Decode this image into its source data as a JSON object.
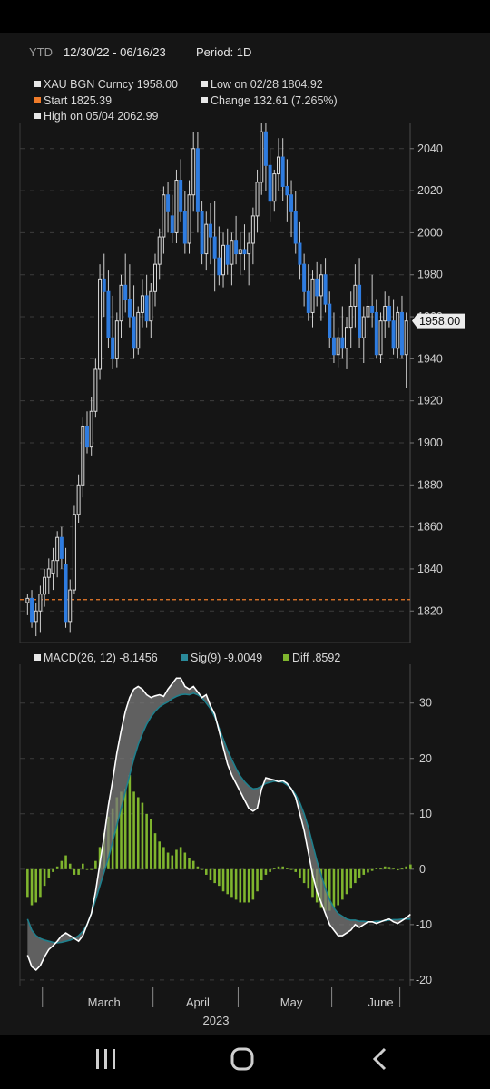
{
  "header": {
    "range_label": "YTD",
    "date_range": "12/30/22 - 06/16/23",
    "period": "Period: 1D"
  },
  "legend": [
    {
      "text": "XAU BGN Curncy 1958.00",
      "color": "#e8e8e8"
    },
    {
      "text": "Low on 02/28 1804.92",
      "color": "#e8e8e8"
    },
    {
      "text": "Start 1825.39",
      "color": "#f07c2a"
    },
    {
      "text": "Change 132.61 (7.265%)",
      "color": "#e8e8e8"
    },
    {
      "text": "High on 05/04 2062.99",
      "color": "#e8e8e8"
    }
  ],
  "last_price_label": "1958.00",
  "macd_legend": [
    {
      "text": "MACD(26, 12) -8.1456",
      "color": "#e8e8e8"
    },
    {
      "text": "Sig(9) -9.0049",
      "color": "#2a8a9a"
    },
    {
      "text": "Diff .8592",
      "color": "#7fb52e"
    }
  ],
  "colors": {
    "up": "#d8d8d8",
    "down": "#2f7ce0",
    "start_line": "#f07c2a",
    "macd": "#ffffff",
    "signal": "#1f7f8c",
    "diff": "#7fb52e",
    "fill": "#7a7a7a"
  },
  "chart_data": [
    {
      "type": "candlestick",
      "title": "XAU BGN Curncy",
      "ylim": [
        1805,
        2052
      ],
      "y_ticks": [
        1820,
        1840,
        1860,
        1880,
        1900,
        1920,
        1940,
        1960,
        1980,
        2000,
        2020,
        2040
      ],
      "start_value": 1825.39,
      "last_value": 1958.0,
      "ohlc": [
        [
          1824,
          1828,
          1818,
          1826
        ],
        [
          1826,
          1830,
          1812,
          1815
        ],
        [
          1815,
          1824,
          1808,
          1820
        ],
        [
          1820,
          1832,
          1810,
          1828
        ],
        [
          1828,
          1840,
          1822,
          1836
        ],
        [
          1836,
          1845,
          1828,
          1840
        ],
        [
          1838,
          1850,
          1830,
          1844
        ],
        [
          1844,
          1858,
          1836,
          1855
        ],
        [
          1855,
          1860,
          1840,
          1845
        ],
        [
          1842,
          1850,
          1812,
          1815
        ],
        [
          1815,
          1835,
          1810,
          1830
        ],
        [
          1830,
          1870,
          1828,
          1866
        ],
        [
          1866,
          1885,
          1862,
          1880
        ],
        [
          1880,
          1912,
          1874,
          1908
        ],
        [
          1908,
          1915,
          1895,
          1898
        ],
        [
          1898,
          1922,
          1894,
          1915
        ],
        [
          1915,
          1940,
          1912,
          1935
        ],
        [
          1935,
          1985,
          1930,
          1978
        ],
        [
          1978,
          1990,
          1960,
          1972
        ],
        [
          1972,
          1982,
          1945,
          1950
        ],
        [
          1950,
          1970,
          1935,
          1940
        ],
        [
          1940,
          1962,
          1936,
          1958
        ],
        [
          1958,
          1980,
          1950,
          1975
        ],
        [
          1975,
          1990,
          1962,
          1968
        ],
        [
          1968,
          1985,
          1955,
          1960
        ],
        [
          1960,
          1975,
          1940,
          1945
        ],
        [
          1945,
          1965,
          1942,
          1962
        ],
        [
          1962,
          1978,
          1955,
          1970
        ],
        [
          1970,
          1980,
          1955,
          1958
        ],
        [
          1958,
          1976,
          1950,
          1972
        ],
        [
          1972,
          1990,
          1965,
          1985
        ],
        [
          1985,
          2002,
          1978,
          1998
        ],
        [
          1998,
          2022,
          1990,
          2018
        ],
        [
          2018,
          2024,
          2000,
          2010
        ],
        [
          2008,
          2018,
          1995,
          2000
        ],
        [
          2000,
          2030,
          1995,
          2025
        ],
        [
          2025,
          2035,
          2005,
          2010
        ],
        [
          2010,
          2020,
          1990,
          1995
        ],
        [
          1995,
          2025,
          1990,
          2018
        ],
        [
          2018,
          2048,
          2010,
          2040
        ],
        [
          2040,
          2048,
          2000,
          2010
        ],
        [
          2010,
          2015,
          1985,
          1990
        ],
        [
          1990,
          2010,
          1982,
          2004
        ],
        [
          2004,
          2014,
          1985,
          1998
        ],
        [
          1998,
          2015,
          1972,
          1988
        ],
        [
          1988,
          2003,
          1975,
          1980
        ],
        [
          1980,
          2000,
          1974,
          1994
        ],
        [
          1994,
          2002,
          1980,
          1985
        ],
        [
          1985,
          2000,
          1975,
          1996
        ],
        [
          1996,
          2008,
          1985,
          1990
        ],
        [
          1990,
          2000,
          1980,
          1992
        ],
        [
          1992,
          2004,
          1982,
          1990
        ],
        [
          1990,
          2000,
          1975,
          1995
        ],
        [
          1995,
          2012,
          1985,
          2008
        ],
        [
          2008,
          2030,
          2000,
          2024
        ],
        [
          2024,
          2052,
          2018,
          2048
        ],
        [
          2048,
          2052,
          2020,
          2032
        ],
        [
          2032,
          2040,
          2005,
          2015
        ],
        [
          2015,
          2030,
          2010,
          2028
        ],
        [
          2028,
          2045,
          2020,
          2036
        ],
        [
          2036,
          2045,
          2015,
          2022
        ],
        [
          2022,
          2035,
          2005,
          2018
        ],
        [
          2018,
          2025,
          1998,
          2010
        ],
        [
          2010,
          2020,
          1990,
          1995
        ],
        [
          1995,
          2005,
          1978,
          1985
        ],
        [
          1985,
          1990,
          1965,
          1972
        ],
        [
          1972,
          1985,
          1958,
          1962
        ],
        [
          1962,
          1982,
          1955,
          1978
        ],
        [
          1978,
          1986,
          1965,
          1970
        ],
        [
          1970,
          1985,
          1958,
          1980
        ],
        [
          1980,
          1988,
          1962,
          1966
        ],
        [
          1966,
          1972,
          1945,
          1950
        ],
        [
          1950,
          1962,
          1938,
          1942
        ],
        [
          1942,
          1955,
          1936,
          1950
        ],
        [
          1950,
          1965,
          1940,
          1945
        ],
        [
          1945,
          1960,
          1935,
          1955
        ],
        [
          1955,
          1972,
          1945,
          1965
        ],
        [
          1965,
          1985,
          1955,
          1975
        ],
        [
          1975,
          1988,
          1945,
          1950
        ],
        [
          1950,
          1965,
          1938,
          1960
        ],
        [
          1960,
          1970,
          1950,
          1965
        ],
        [
          1965,
          1980,
          1955,
          1962
        ],
        [
          1962,
          1968,
          1940,
          1942
        ],
        [
          1942,
          1962,
          1938,
          1958
        ],
        [
          1958,
          1972,
          1950,
          1965
        ],
        [
          1965,
          1970,
          1955,
          1958
        ],
        [
          1958,
          1968,
          1942,
          1945
        ],
        [
          1945,
          1965,
          1940,
          1962
        ],
        [
          1962,
          1970,
          1940,
          1942
        ],
        [
          1942,
          1962,
          1926,
          1958
        ]
      ]
    },
    {
      "type": "macd",
      "series": [
        {
          "name": "MACD(26, 12)",
          "values": [
            -15.5,
            -17.6,
            -18.2,
            -17.4,
            -15.8,
            -14.5,
            -13.8,
            -13,
            -12,
            -11.5,
            -12,
            -12.5,
            -13,
            -12,
            -10,
            -8,
            -4,
            1,
            6,
            11.5,
            16,
            21,
            25,
            28.5,
            31,
            32.5,
            33,
            32.5,
            31.5,
            31,
            31.3,
            31.5,
            31.2,
            32.5,
            33.5,
            34.5,
            34.5,
            33,
            32.5,
            33,
            32,
            31,
            31.5,
            29.5,
            28,
            25,
            22,
            19,
            17,
            15.5,
            14,
            12.5,
            11,
            10.5,
            11,
            14.5,
            16.5,
            16.3,
            16.1,
            15.8,
            16,
            15.5,
            14.5,
            13,
            10,
            7,
            3,
            -1,
            -4,
            -6,
            -8,
            -10,
            -11,
            -12,
            -12,
            -11.5,
            -11,
            -10,
            -10.5,
            -10,
            -9.5,
            -9.5,
            -9.8,
            -9.5,
            -9.2,
            -9,
            -9.5,
            -9.8,
            -9.3,
            -8.8,
            -8.1456
          ]
        },
        {
          "name": "Sig(9)",
          "values": [
            -9,
            -11,
            -12,
            -12.5,
            -12.8,
            -13,
            -13.2,
            -13.3,
            -13.2,
            -13,
            -12.8,
            -12.5,
            -12,
            -11.2,
            -10,
            -8,
            -5.5,
            -3,
            -0.5,
            2,
            5,
            8,
            11,
            14,
            17,
            20,
            22.5,
            24.5,
            26.2,
            27.5,
            28.5,
            29.3,
            29.8,
            30.2,
            30.8,
            31.2,
            31.5,
            31.6,
            31.5,
            31.8,
            31.5,
            31,
            30,
            29,
            27.5,
            25.5,
            23.5,
            21.5,
            19.8,
            18.2,
            16.8,
            15.8,
            15,
            14.5,
            14.6,
            15,
            15.5,
            15.7,
            15.9,
            15.8,
            15.7,
            15.2,
            14.5,
            13.5,
            12,
            10,
            7.5,
            4.5,
            1.5,
            -1,
            -3.5,
            -5.5,
            -7,
            -8,
            -8.5,
            -9,
            -9.2,
            -9.2,
            -9.4,
            -9.4,
            -9.5,
            -9.5,
            -9.4,
            -9.4,
            -9.3,
            -9.2,
            -9.1,
            -9.1,
            -9.0,
            -9.0,
            -9.0049
          ]
        },
        {
          "name": "Diff",
          "values": [
            -5,
            -6.5,
            -6,
            -5,
            -3,
            -1.5,
            -0.5,
            0.5,
            1.5,
            2.5,
            1,
            -1,
            -1,
            1,
            0,
            0,
            1.5,
            4,
            6.5,
            9.5,
            11,
            13,
            14,
            14.5,
            17,
            14,
            13,
            12,
            10,
            9,
            6.5,
            5,
            4,
            3,
            2.5,
            3.5,
            4,
            3,
            2,
            1.5,
            0.5,
            0,
            -1,
            -2,
            -2.5,
            -3,
            -4,
            -4.5,
            -5,
            -5.5,
            -6,
            -6,
            -6,
            -5.5,
            -4,
            -2,
            -1,
            -0.5,
            0.2,
            0.5,
            0.5,
            0.3,
            0,
            -0.5,
            -1.5,
            -2.5,
            -3.5,
            -5,
            -6,
            -7,
            -7.5,
            -7.5,
            -7,
            -6.5,
            -5.5,
            -4.5,
            -3.5,
            -2.5,
            -1.5,
            -1,
            -0.6,
            -0.3,
            0.2,
            0.3,
            0.5,
            0.4,
            0.1,
            -0.2,
            0.3,
            0.5,
            0.8592
          ]
        }
      ],
      "ylim": [
        -21,
        37
      ],
      "y_ticks": [
        -20,
        -10,
        0,
        10,
        20,
        30
      ]
    }
  ],
  "x_axis": {
    "month_labels": [
      {
        "label": "March",
        "index": 18
      },
      {
        "label": "April",
        "index": 40
      },
      {
        "label": "May",
        "index": 62
      },
      {
        "label": "June",
        "index": 83
      }
    ],
    "separators": [
      4,
      30,
      50,
      72,
      88
    ],
    "year_label": "2023"
  }
}
